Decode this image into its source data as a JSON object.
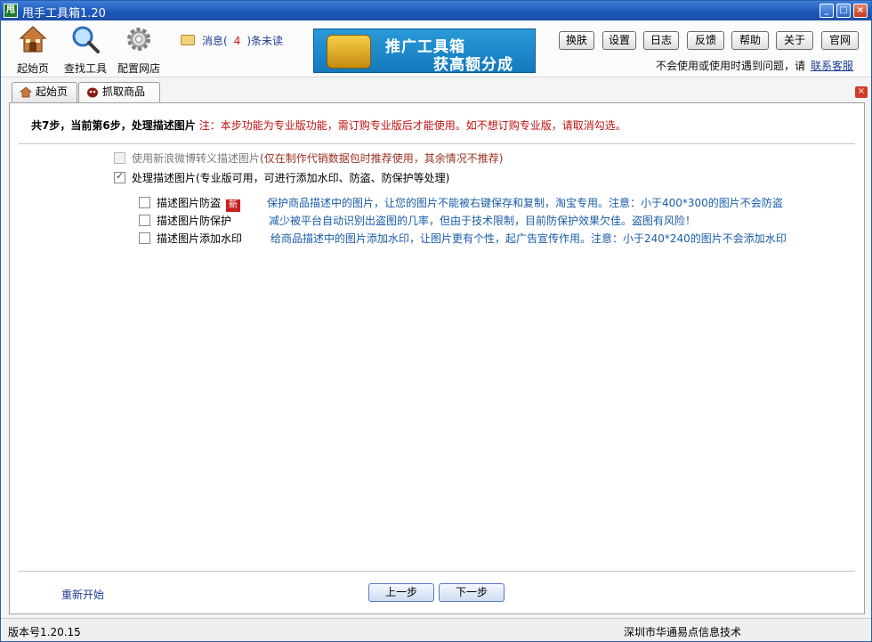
{
  "window": {
    "app_icon": "甩",
    "title": "甩手工具箱1.20",
    "min": "_",
    "max": "□",
    "close": "×"
  },
  "toolbar": {
    "home_label": "起始页",
    "find_label": "查找工具",
    "config_label": "配置网店",
    "msg_prefix": "消息(",
    "msg_count": "4",
    "msg_suffix": ")条未读",
    "banner_line1": "推广工具箱",
    "banner_line2": "获高额分成",
    "buttons": [
      "换肤",
      "设置",
      "日志",
      "反馈",
      "帮助",
      "关于",
      "官网"
    ],
    "help_text": "不会使用或使用时遇到问题，请",
    "help_link": "联系客服"
  },
  "tabs": {
    "home": "起始页",
    "grab": "抓取商品",
    "close": "×"
  },
  "main": {
    "step_text": "共7步，当前第6步，处理描述图片",
    "step_warning": "注：本步功能为专业版功能，需订购专业版后才能使用。如不想订购专业版，请取消勾选。",
    "opt_weibo_label": "使用新浪微博转义描述图片",
    "opt_weibo_note": "(仅在制作代销数据包时推荐使用，其余情况不推荐)",
    "opt_process_label": "处理描述图片(专业版可用，可进行添加水印、防盗、防保护等处理)",
    "sub_options": [
      {
        "label": "描述图片防盗",
        "badge": "新",
        "desc": "保护商品描述中的图片，让您的图片不能被右键保存和复制，淘宝专用。注意：小于400*300的图片不会防盗"
      },
      {
        "label": "描述图片防保护",
        "desc": "减少被平台自动识别出盗图的几率，但由于技术限制，目前防保护效果欠佳。盗图有风险！"
      },
      {
        "label": "描述图片添加水印",
        "desc": "给商品描述中的图片添加水印，让图片更有个性，起广告宣传作用。注意：小于240*240的图片不会添加水印"
      }
    ],
    "restart": "重新开始",
    "prev": "上一步",
    "next": "下一步"
  },
  "status": {
    "version": "版本号1.20.15",
    "company": "深圳市华通易点信息技术"
  }
}
